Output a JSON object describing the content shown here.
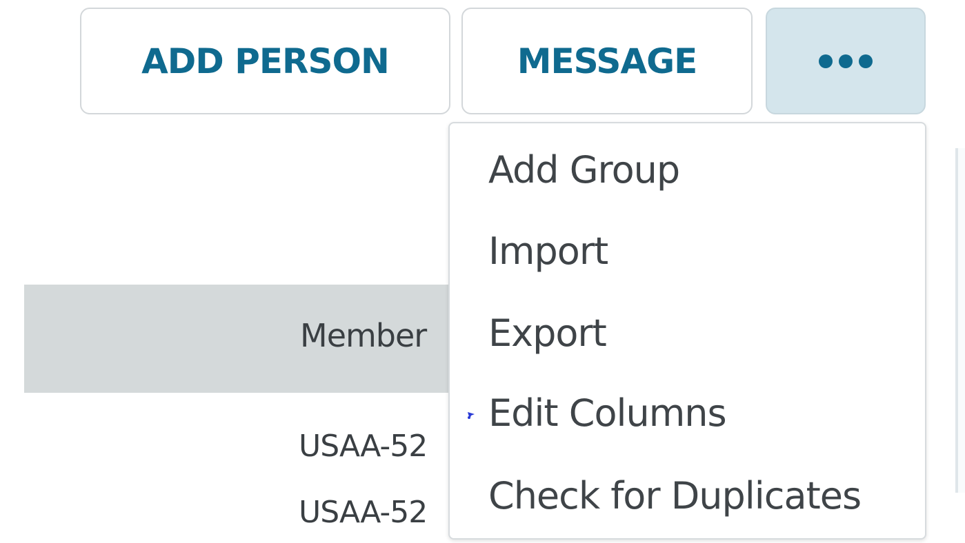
{
  "toolbar": {
    "add_person_label": "ADD PERSON",
    "message_label": "MESSAGE",
    "more_icon": "more-horizontal-icon"
  },
  "table": {
    "header_label": "Member",
    "rows": [
      "USAA-52",
      "USAA-52"
    ]
  },
  "dropdown": {
    "items": [
      "Add Group",
      "Import",
      "Export",
      "Edit Columns",
      "Check for Duplicates"
    ]
  },
  "colors": {
    "accent": "#0f6a8f",
    "more_button_bg": "#d4e5ec",
    "table_header_bg": "#d4d9da",
    "text": "#3f4448"
  }
}
